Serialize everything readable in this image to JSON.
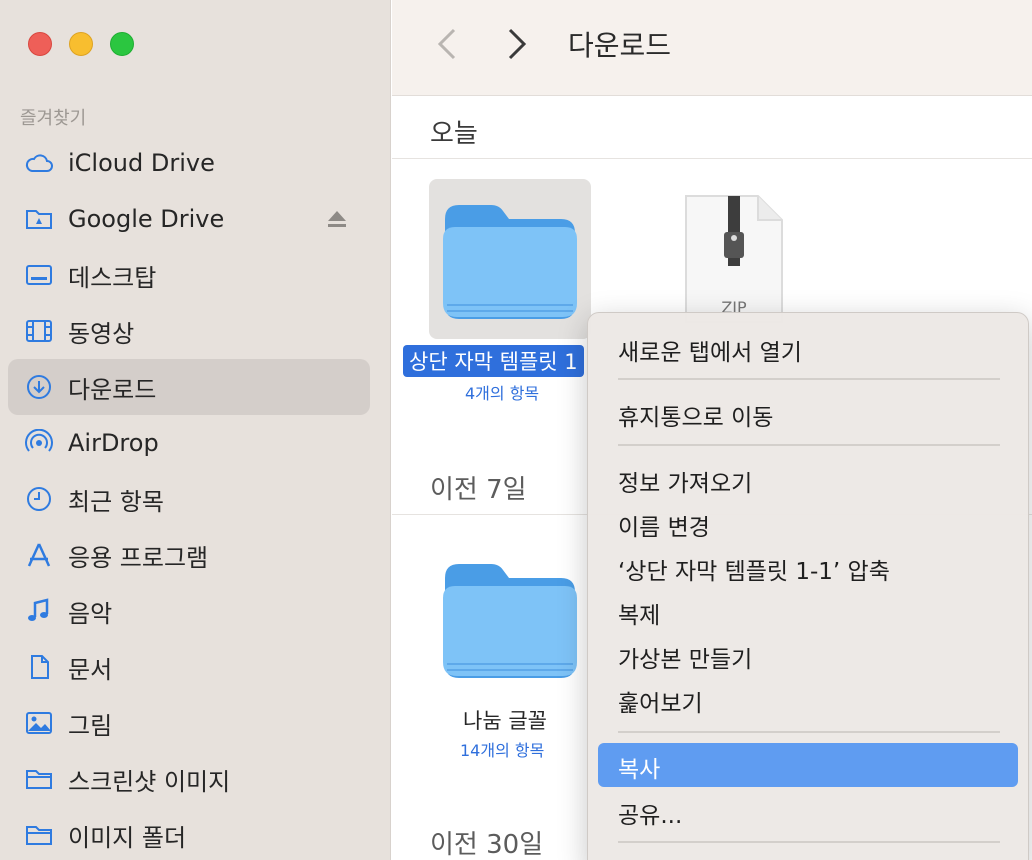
{
  "sidebar": {
    "section": "즐겨찾기",
    "items": [
      {
        "label": "iCloud Drive",
        "icon": "cloud-icon"
      },
      {
        "label": "Google Drive",
        "icon": "google-drive-folder-icon"
      },
      {
        "label": "데스크탑",
        "icon": "desktop-icon"
      },
      {
        "label": "동영상",
        "icon": "film-icon"
      },
      {
        "label": "다운로드",
        "icon": "download-icon"
      },
      {
        "label": "AirDrop",
        "icon": "airdrop-icon"
      },
      {
        "label": "최근 항목",
        "icon": "clock-icon"
      },
      {
        "label": "응용 프로그램",
        "icon": "applications-icon"
      },
      {
        "label": "음악",
        "icon": "music-note-icon"
      },
      {
        "label": "문서",
        "icon": "document-icon"
      },
      {
        "label": "그림",
        "icon": "picture-icon"
      },
      {
        "label": "스크린샷 이미지",
        "icon": "folder-icon"
      },
      {
        "label": "이미지 폴더",
        "icon": "folder-icon"
      }
    ]
  },
  "toolbar": {
    "title": "다운로드"
  },
  "groups": {
    "today": "오늘",
    "last7": "이전 7일",
    "last30": "이전 30일"
  },
  "files": {
    "folder1": {
      "name": "상단 자막 템플릿 1",
      "count": "4개의 항목"
    },
    "zip": {
      "type_label": "ZIP"
    },
    "folder2": {
      "name": "나눔 글꼴",
      "count": "14개의 항목"
    }
  },
  "menu": {
    "items": [
      "새로운 탭에서 열기",
      "휴지통으로 이동",
      "정보 가져오기",
      "이름 변경",
      "‘상단 자막 템플릿 1-1’ 압축",
      "복제",
      "가상본 만들기",
      "훑어보기",
      "복사",
      "공유..."
    ]
  },
  "colors": {
    "accent": "#2f6fdc",
    "highlight": "#5f9cf1",
    "folder": "#64b5f0",
    "icon_blue": "#2f7be0"
  }
}
